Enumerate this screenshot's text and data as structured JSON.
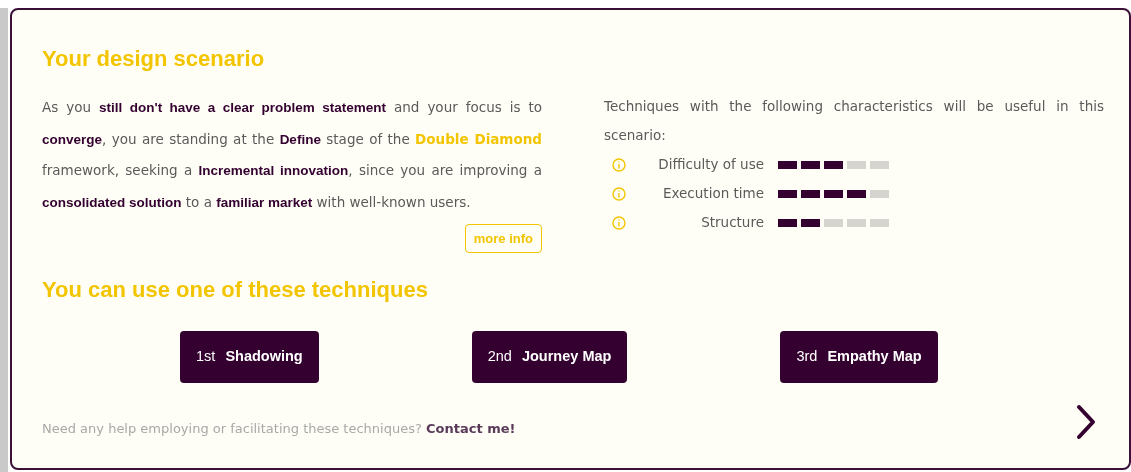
{
  "scenario": {
    "title": "Your design scenario",
    "description": [
      {
        "kind": "text",
        "text": "As you **still don't have a clear problem statement** and your focus is to **converge**, you are standing at the **Define** stage of the "
      },
      {
        "kind": "link",
        "text": "Double Diamond"
      },
      {
        "kind": "text",
        "text": " framework, seeking a **Incremental innovation**, since you are improving a **consolidated solution** to a **familiar market** with well-known users."
      }
    ],
    "more_info": "more info"
  },
  "characteristics": {
    "intro": "Techniques with the following characteristics will be useful in this scenario:",
    "items": [
      {
        "label": "Difficulty of use",
        "level": 0.6
      },
      {
        "label": "Execution time",
        "level": 0.8
      },
      {
        "label": "Structure",
        "level": 0.4
      }
    ]
  },
  "techniques": {
    "title": "You can use one of these techniques",
    "items": [
      {
        "rank": "1st",
        "name": "Shadowing"
      },
      {
        "rank": "2nd",
        "name": "Journey Map"
      },
      {
        "rank": "3rd",
        "name": "Empathy Map"
      }
    ]
  },
  "footer": {
    "text": "Need any help employing or facilitating these techniques?",
    "link": "Contact me!"
  }
}
